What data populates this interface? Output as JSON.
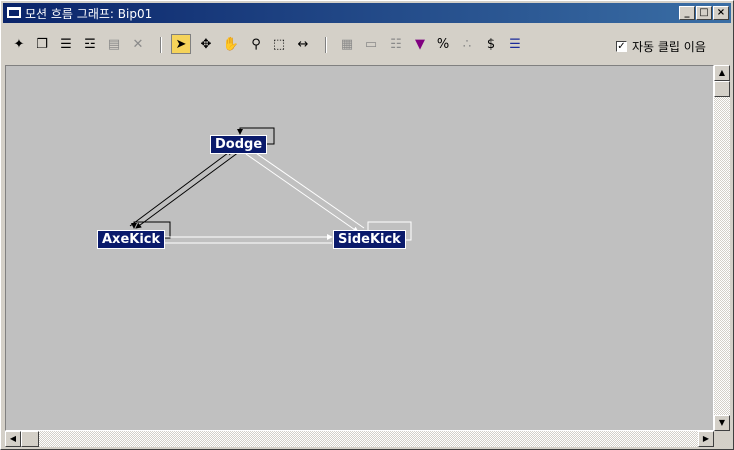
{
  "window": {
    "title": "모션 흐름 그래프: Bip01"
  },
  "titlebar": {
    "min": "_",
    "max": "□",
    "close": "×"
  },
  "toolbar": {
    "tools": [
      {
        "name": "new-state-icon",
        "glyph": "✦"
      },
      {
        "name": "open-icon",
        "glyph": "❐"
      },
      {
        "name": "add-clip-icon",
        "glyph": "☰"
      },
      {
        "name": "add-clip2-icon",
        "glyph": "☲"
      },
      {
        "name": "delete-transition-icon",
        "glyph": "▤"
      },
      {
        "name": "delete-icon",
        "glyph": "✕"
      },
      {
        "name": "select-icon",
        "glyph": "➤"
      },
      {
        "name": "move-icon",
        "glyph": "✥"
      },
      {
        "name": "pan-icon",
        "glyph": "✋"
      },
      {
        "name": "zoom-icon",
        "glyph": "⚲"
      },
      {
        "name": "zoom-region-icon",
        "glyph": "⬚"
      },
      {
        "name": "zoom-extents-icon",
        "glyph": "↔"
      },
      {
        "name": "properties-icon",
        "glyph": "▦"
      },
      {
        "name": "rectangle-icon",
        "glyph": "▭"
      },
      {
        "name": "query-icon",
        "glyph": "☷"
      },
      {
        "name": "select-random-icon",
        "glyph": "▼"
      },
      {
        "name": "percent-icon",
        "glyph": "%"
      },
      {
        "name": "random-icon",
        "glyph": "∴"
      },
      {
        "name": "cost-icon",
        "glyph": "$"
      },
      {
        "name": "script-icon",
        "glyph": "☰"
      }
    ],
    "auto_scroll_label": "자동 클립 이음",
    "auto_scroll_checked": "✓"
  },
  "graph": {
    "nodes": [
      {
        "name": "node-dodge",
        "label": "Dodge"
      },
      {
        "name": "node-axekick",
        "label": "AxeKick"
      },
      {
        "name": "node-sidekick",
        "label": "SideKick"
      }
    ]
  },
  "scroll": {
    "up": "▲",
    "down": "▼",
    "left": "◀",
    "right": "▶"
  }
}
